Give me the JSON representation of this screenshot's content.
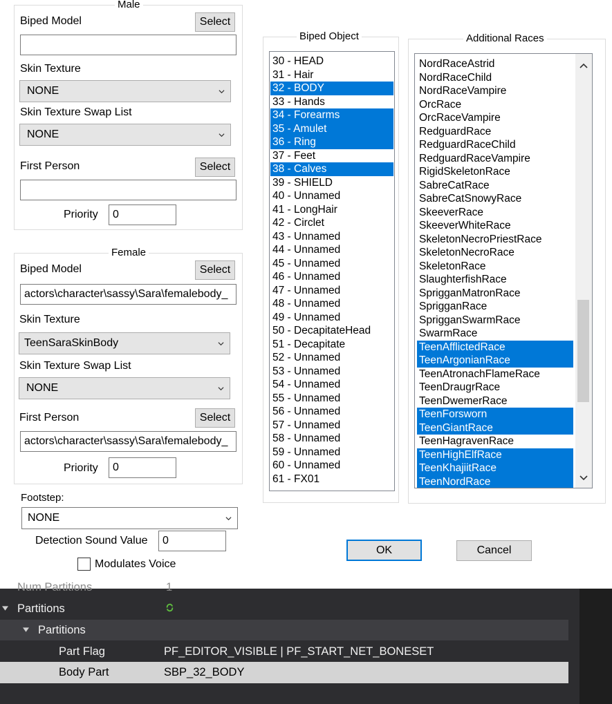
{
  "male": {
    "title": "Male",
    "biped_model_label": "Biped Model",
    "select_label": "Select",
    "biped_model_value": "",
    "skin_texture_label": "Skin Texture",
    "skin_texture_value": "NONE",
    "swap_list_label": "Skin Texture Swap List",
    "swap_list_value": "NONE",
    "first_person_label": "First Person",
    "first_person_value": "",
    "priority_label": "Priority",
    "priority_value": "0"
  },
  "female": {
    "title": "Female",
    "biped_model_label": "Biped Model",
    "select_label": "Select",
    "biped_model_value": "actors\\character\\sassy\\Sara\\femalebody_",
    "skin_texture_label": "Skin Texture",
    "skin_texture_value": "TeenSaraSkinBody",
    "swap_list_label": "Skin Texture Swap List",
    "swap_list_value": "NONE",
    "first_person_label": "First Person",
    "first_person_value": "actors\\character\\sassy\\Sara\\femalebody_",
    "priority_label": "Priority",
    "priority_value": "0"
  },
  "footstep": {
    "label": "Footstep:",
    "value": "NONE",
    "detection_label": "Detection Sound Value",
    "detection_value": "0",
    "modulates_label": "Modulates Voice",
    "modulates_checked": false
  },
  "biped_object": {
    "title": "Biped Object",
    "items": [
      {
        "label": "30 - HEAD",
        "selected": false
      },
      {
        "label": "31 - Hair",
        "selected": false
      },
      {
        "label": "32 - BODY",
        "selected": true
      },
      {
        "label": "33 - Hands",
        "selected": false
      },
      {
        "label": "34 - Forearms",
        "selected": true
      },
      {
        "label": "35 - Amulet",
        "selected": true
      },
      {
        "label": "36 - Ring",
        "selected": true
      },
      {
        "label": "37 - Feet",
        "selected": false
      },
      {
        "label": "38 - Calves",
        "selected": true
      },
      {
        "label": "39 - SHIELD",
        "selected": false
      },
      {
        "label": "40 - Unnamed",
        "selected": false
      },
      {
        "label": "41 - LongHair",
        "selected": false
      },
      {
        "label": "42 - Circlet",
        "selected": false
      },
      {
        "label": "43 - Unnamed",
        "selected": false
      },
      {
        "label": "44 - Unnamed",
        "selected": false
      },
      {
        "label": "45 - Unnamed",
        "selected": false
      },
      {
        "label": "46 - Unnamed",
        "selected": false
      },
      {
        "label": "47 - Unnamed",
        "selected": false
      },
      {
        "label": "48 - Unnamed",
        "selected": false
      },
      {
        "label": "49 - Unnamed",
        "selected": false
      },
      {
        "label": "50 - DecapitateHead",
        "selected": false
      },
      {
        "label": "51 - Decapitate",
        "selected": false
      },
      {
        "label": "52 - Unnamed",
        "selected": false
      },
      {
        "label": "53 - Unnamed",
        "selected": false
      },
      {
        "label": "54 - Unnamed",
        "selected": false
      },
      {
        "label": "55 - Unnamed",
        "selected": false
      },
      {
        "label": "56 - Unnamed",
        "selected": false
      },
      {
        "label": "57 - Unnamed",
        "selected": false
      },
      {
        "label": "58 - Unnamed",
        "selected": false
      },
      {
        "label": "59 - Unnamed",
        "selected": false
      },
      {
        "label": "60 - Unnamed",
        "selected": false
      },
      {
        "label": "61 - FX01",
        "selected": false
      }
    ]
  },
  "additional_races": {
    "title": "Additional Races",
    "items": [
      {
        "label": "NordRaceAstrid",
        "selected": false
      },
      {
        "label": "NordRaceChild",
        "selected": false
      },
      {
        "label": "NordRaceVampire",
        "selected": false
      },
      {
        "label": "OrcRace",
        "selected": false
      },
      {
        "label": "OrcRaceVampire",
        "selected": false
      },
      {
        "label": "RedguardRace",
        "selected": false
      },
      {
        "label": "RedguardRaceChild",
        "selected": false
      },
      {
        "label": "RedguardRaceVampire",
        "selected": false
      },
      {
        "label": "RigidSkeletonRace",
        "selected": false
      },
      {
        "label": "SabreCatRace",
        "selected": false
      },
      {
        "label": "SabreCatSnowyRace",
        "selected": false
      },
      {
        "label": "SkeeverRace",
        "selected": false
      },
      {
        "label": "SkeeverWhiteRace",
        "selected": false
      },
      {
        "label": "SkeletonNecroPriestRace",
        "selected": false
      },
      {
        "label": "SkeletonNecroRace",
        "selected": false
      },
      {
        "label": "SkeletonRace",
        "selected": false
      },
      {
        "label": "SlaughterfishRace",
        "selected": false
      },
      {
        "label": "SprigganMatronRace",
        "selected": false
      },
      {
        "label": "SprigganRace",
        "selected": false
      },
      {
        "label": "SprigganSwarmRace",
        "selected": false
      },
      {
        "label": "SwarmRace",
        "selected": false
      },
      {
        "label": "TeenAfflictedRace",
        "selected": true
      },
      {
        "label": "TeenArgonianRace",
        "selected": true
      },
      {
        "label": "TeenAtronachFlameRace",
        "selected": false
      },
      {
        "label": "TeenDraugrRace",
        "selected": false
      },
      {
        "label": "TeenDwemerRace",
        "selected": false
      },
      {
        "label": "TeenForsworn",
        "selected": true
      },
      {
        "label": "TeenGiantRace",
        "selected": true
      },
      {
        "label": "TeenHagravenRace",
        "selected": false
      },
      {
        "label": "TeenHighElfRace",
        "selected": true
      },
      {
        "label": "TeenKhajiitRace",
        "selected": true
      },
      {
        "label": "TeenNordRace",
        "selected": true
      }
    ]
  },
  "dialog_buttons": {
    "ok": "OK",
    "cancel": "Cancel"
  },
  "properties": {
    "cut_row_label": "Num Partitions",
    "cut_row_value": "1",
    "partitions_label": "Partitions",
    "partitions_child_label": "Partitions",
    "part_flag_label": "Part Flag",
    "part_flag_value": "PF_EDITOR_VISIBLE | PF_START_NET_BONESET",
    "body_part_label": "Body Part",
    "body_part_value": "SBP_32_BODY"
  },
  "colors": {
    "selection": "#0078d7",
    "dialog_bg": "#ffffff",
    "panel_dark": "#2d2d30",
    "row_selected": "#d4d4d4"
  }
}
